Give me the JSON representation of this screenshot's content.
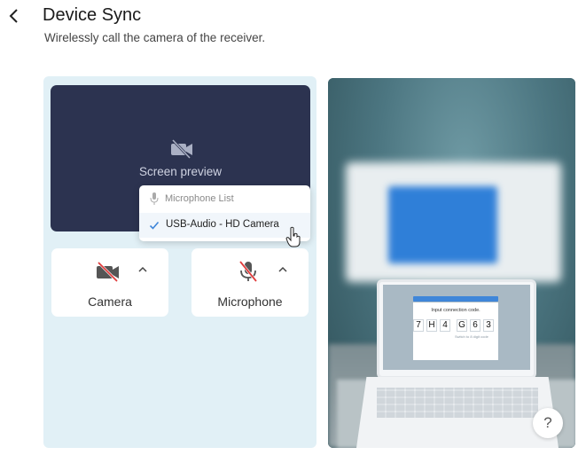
{
  "header": {
    "title": "Device Sync",
    "subtitle": "Wirelessly call the camera of the receiver.",
    "back_icon": "chevron-left-icon"
  },
  "preview": {
    "label": "Screen preview",
    "icon": "camera-off-icon"
  },
  "camera_card": {
    "label": "Camera",
    "icon": "camera-off-icon",
    "chevron_icon": "chevron-up-icon"
  },
  "microphone_card": {
    "label": "Microphone",
    "icon": "microphone-off-icon",
    "chevron_icon": "chevron-up-icon"
  },
  "microphone_dropdown": {
    "header": "Microphone List",
    "items": [
      {
        "label": "USB-Audio - HD Camera",
        "selected": true
      }
    ]
  },
  "illustration": {
    "dialog_title": "Input connection code.",
    "code": [
      "7",
      "H",
      "4",
      "G",
      "6",
      "3"
    ],
    "hint": "Switch to 8 digit code"
  },
  "help_button": {
    "label": "?"
  },
  "colors": {
    "accent": "#3f86d9",
    "panel_bg": "#e1f0f6",
    "preview_bg": "#2c3350",
    "off_red": "#e03c3c"
  }
}
